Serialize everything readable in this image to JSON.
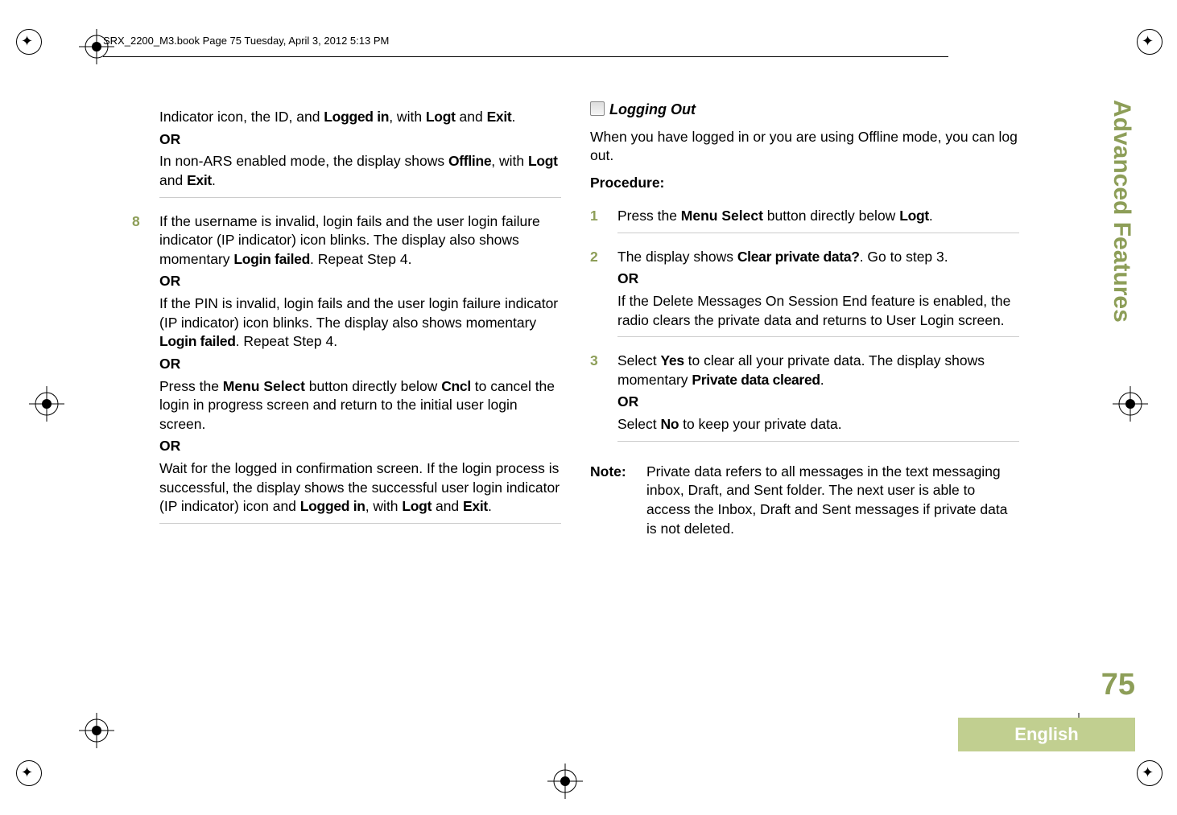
{
  "header_line": "SRX_2200_M3.book  Page 75  Tuesday, April 3, 2012  5:13 PM",
  "col1": {
    "para0": "Indicator icon, the ID, and ",
    "span1": "Logged in",
    "span2": ", with ",
    "span3": "Logt",
    "span4": " and ",
    "span5": "Exit",
    "span6": ".",
    "or1": "OR",
    "nonars1": "In non-ARS enabled mode, the display shows ",
    "nonars2": "Offline",
    "nonars3": ", with ",
    "nonars4": "Logt",
    "nonars5": " and ",
    "nonars6": "Exit",
    "nonars7": ".",
    "step8num": "8",
    "s8p1a": "If the username is invalid, login fails and the user login failure indicator (IP indicator) icon blinks. The display also shows momentary ",
    "s8p1b": "Login failed",
    "s8p1c": ". Repeat Step 4.",
    "or2": "OR",
    "s8p2a": "If the PIN is invalid, login fails and the user login failure indicator (IP indicator) icon blinks. The display also shows momentary ",
    "s8p2b": "Login failed",
    "s8p2c": ". Repeat Step 4.",
    "or3": "OR",
    "s8p3a": "Press the ",
    "s8p3b": "Menu Select",
    "s8p3c": " button directly below ",
    "s8p3d": "Cncl",
    "s8p3e": " to cancel the login in progress screen and return to the initial user login screen.",
    "or4": "OR",
    "s8p4a": "Wait for the logged in confirmation screen. If the login process is successful, the display shows the successful user login indicator (IP indicator) icon and ",
    "s8p4b": "Logged in",
    "s8p4c": ", with ",
    "s8p4d": "Logt",
    "s8p4e": " and ",
    "s8p4f": "Exit",
    "s8p4g": "."
  },
  "col2": {
    "heading": "Logging Out",
    "intro": "When you have logged in or you are using Offline mode, you can log out.",
    "procedure": "Procedure:",
    "s1num": "1",
    "s1a": "Press the ",
    "s1b": "Menu Select",
    "s1c": " button directly below ",
    "s1d": "Logt",
    "s1e": ".",
    "s2num": "2",
    "s2a": "The display shows ",
    "s2b": "Clear private data?",
    "s2c": ". Go to step 3.",
    "or1": "OR",
    "s2d": "If the Delete Messages On Session End feature is enabled, the radio clears the private data and returns to User Login screen.",
    "s3num": "3",
    "s3a": "Select ",
    "s3b": "Yes",
    "s3c": " to clear all your private data. The display shows momentary ",
    "s3d": "Private data cleared",
    "s3e": ".",
    "or2": "OR",
    "s3f": "Select ",
    "s3g": "No",
    "s3h": " to keep your private data.",
    "notelabel": "Note:",
    "notetext": "Private data refers to all messages in the text messaging inbox, Draft, and Sent folder. The next user is able to access the Inbox, Draft and Sent messages if private data is not deleted."
  },
  "sidetab": "Advanced Features",
  "pagenum": "75",
  "lang": "English"
}
